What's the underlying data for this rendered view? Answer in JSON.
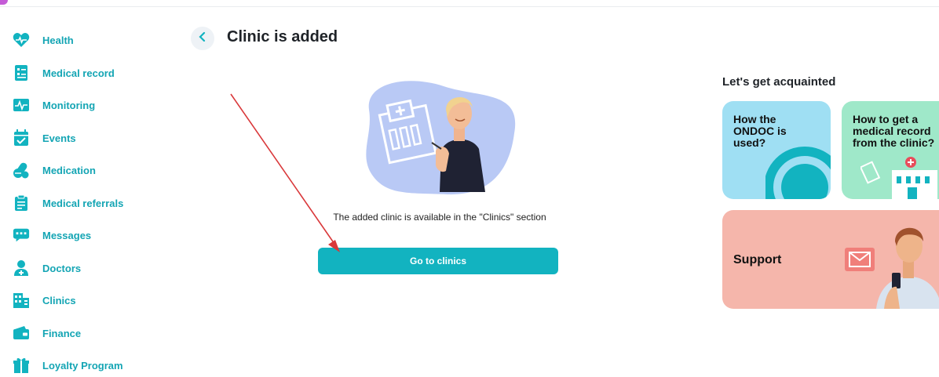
{
  "sidebar": {
    "items": [
      {
        "label": "Health",
        "icon": "heart-icon"
      },
      {
        "label": "Medical record",
        "icon": "medical-record-icon"
      },
      {
        "label": "Monitoring",
        "icon": "monitoring-icon"
      },
      {
        "label": "Events",
        "icon": "calendar-icon"
      },
      {
        "label": "Medication",
        "icon": "pills-icon"
      },
      {
        "label": "Medical referrals",
        "icon": "clipboard-icon"
      },
      {
        "label": "Messages",
        "icon": "chat-icon"
      },
      {
        "label": "Doctors",
        "icon": "doctor-icon"
      },
      {
        "label": "Clinics",
        "icon": "building-icon"
      },
      {
        "label": "Finance",
        "icon": "wallet-icon"
      },
      {
        "label": "Loyalty Program",
        "icon": "gift-icon"
      }
    ],
    "icon_color": "#12b3c0",
    "label_color": "#14a5b4"
  },
  "main": {
    "title": "Clinic is added",
    "info_text": "The added clinic is available in the \"Clinics\" section",
    "button_label": "Go to clinics",
    "accent_color": "#12b3c0"
  },
  "right_panel": {
    "title": "Let's get acquainted",
    "cards": [
      {
        "text": "How the ONDOC is used?",
        "color": "#9fdff3"
      },
      {
        "text": "How to get a medical record from the clinic?",
        "color": "#9fe8c9"
      },
      {
        "text": "Support",
        "color": "#f5b6ab"
      }
    ]
  }
}
